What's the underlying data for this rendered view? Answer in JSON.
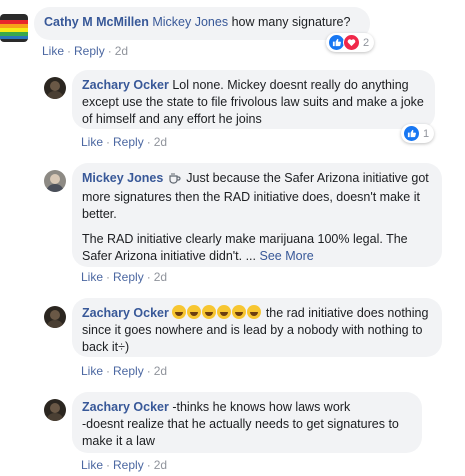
{
  "colors": {
    "author_link": "#385898",
    "meta_link": "#4b67a1",
    "meta_text": "#90949c",
    "bubble_bg": "#f2f3f5",
    "like_blue": "#1877f2",
    "love_red": "#f0284a"
  },
  "actions": {
    "like": "Like",
    "reply": "Reply",
    "dot": "·"
  },
  "comments": [
    {
      "author": "Cathy M McMillen",
      "mention": "Mickey Jones",
      "text": "how many signature?",
      "time": "2d",
      "reactions": {
        "icons": [
          "like-icon",
          "love-icon"
        ],
        "count": "2"
      }
    },
    {
      "author": "Zachary Ocker",
      "text": "Lol none. Mickey doesnt really do anything except use the state to file frivolous law suits and make a joke of himself and any effort he joins",
      "time": "2d",
      "reactions": {
        "icons": [
          "like-icon"
        ],
        "count": "1"
      }
    },
    {
      "author": "Mickey Jones",
      "badge_icon": "coffee-cup-icon",
      "text": "Just because the Safer Arizona initiative got more signatures then the RAD initiative does, doesn't make it better.",
      "text2": "The RAD initiative clearly make marijuana 100% legal. The Safer Arizona initiative didn't. ...",
      "see_more": "See More",
      "time": "2d"
    },
    {
      "author": "Zachary Ocker",
      "emoji_icon": "rofl-emoji-icon",
      "emoji_count": 6,
      "text": "the rad initiative does nothing since it goes nowhere and is lead by a nobody with nothing to back it÷)",
      "time": "2d"
    },
    {
      "author": "Zachary Ocker",
      "lines": [
        "-thinks he knows how laws work",
        "-doesnt realize that he actually needs to get signatures to make it a law"
      ],
      "time": "2d"
    }
  ]
}
